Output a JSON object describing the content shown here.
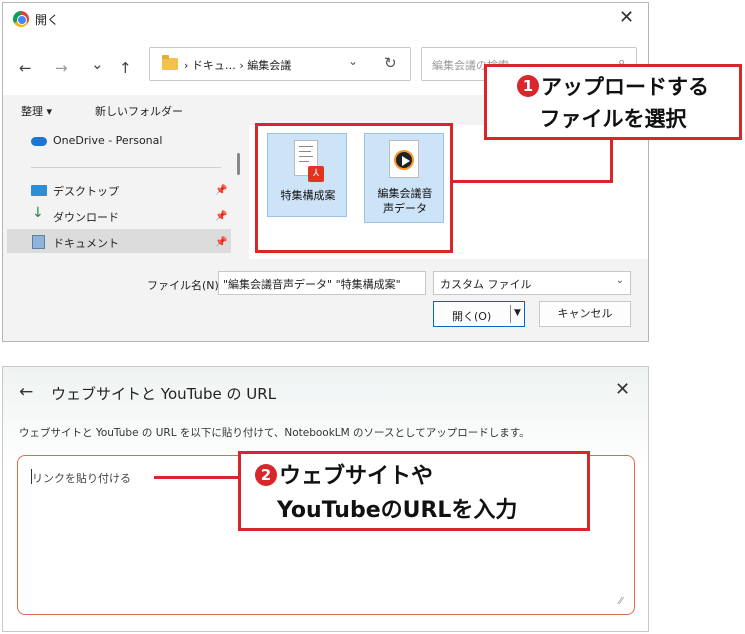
{
  "file_dialog": {
    "title": "開く",
    "nav": {
      "back": "←",
      "forward": "→",
      "recent": "⌄",
      "up": "↑"
    },
    "address": {
      "path": "› ドキュ… › 編集会議",
      "dropdown": "⌄",
      "refresh": "↻"
    },
    "search": {
      "placeholder": "編集会議の検索",
      "icon": "⌕"
    },
    "commands": {
      "organize": "整理 ▾",
      "new_folder": "新しいフォルダー"
    },
    "sidebar": [
      {
        "label": "OneDrive - Personal",
        "icon": "cloud-icon"
      },
      {
        "label": "デスクトップ",
        "icon": "desktop-icon",
        "pinned": true
      },
      {
        "label": "ダウンロード",
        "icon": "download-icon",
        "pinned": true
      },
      {
        "label": "ドキュメント",
        "icon": "documents-icon",
        "pinned": true,
        "selected": true
      }
    ],
    "pin_glyph": "📌",
    "files": [
      {
        "name": "特集構成案",
        "type": "pdf",
        "badge": "⅄"
      },
      {
        "name": "編集会議音声データ",
        "name_lines": [
          "編集会議音",
          "声データ"
        ],
        "type": "audio"
      }
    ],
    "filename_label": "ファイル名(N):",
    "filename_value": "\"編集会議音声データ\" \"特集構成案\"",
    "filetype": "カスタム ファイル",
    "filetype_chev": "⌄",
    "open_button": "開く(O)",
    "open_dropdown": "▼",
    "cancel_button": "キャンセル",
    "close": "✕"
  },
  "callout1": {
    "number": "1",
    "line1": "アップロードする",
    "line2": "ファイルを選択"
  },
  "url_dialog": {
    "back": "←",
    "title": "ウェブサイトと YouTube の URL",
    "close": "✕",
    "description": "ウェブサイトと YouTube の URL を以下に貼り付けて、NotebookLM のソースとしてアップロードします。",
    "placeholder": "リンクを貼り付ける",
    "resize": "⁄⁄"
  },
  "callout2": {
    "number": "2",
    "line1": "ウェブサイトや",
    "line2": "YouTubeのURLを入力"
  },
  "colors": {
    "accent_red": "#d9262b",
    "selection_blue": "#cde3f7",
    "focus_border": "#e06b4b"
  }
}
